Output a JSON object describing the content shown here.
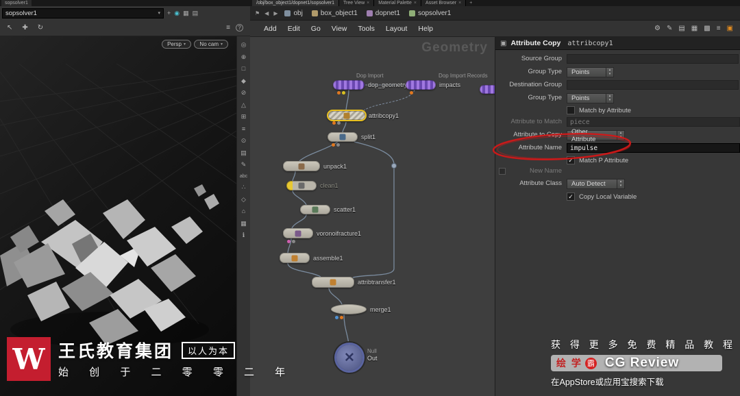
{
  "tabs_bar": {
    "left_tab": "sopsolver1",
    "path_tab": "/obj/box_object1/dopnet1/sopsolver1",
    "tabs": [
      "Tree View",
      "Material Palette",
      "Asset Browser"
    ],
    "close_glyph": "×",
    "add_glyph": "+"
  },
  "viewport": {
    "path_value": "sopsolver1",
    "dropdown_arrow": "▾",
    "header_icons": [
      "+",
      "◉",
      "▦",
      "▤"
    ],
    "toolbar_icons": [
      "↖",
      "✚",
      "↻"
    ],
    "toolbar_right_icons": [
      "≡",
      "?"
    ],
    "persp_label": "Persp",
    "cam_label": "No cam",
    "side_icons": [
      "◎",
      "⊕",
      "□",
      "◆",
      "⊘",
      "△",
      "⊞",
      "≡",
      "⊙",
      "▤",
      "✎",
      "abc",
      "∴",
      "◇",
      "⌂",
      "▦",
      "ℹ"
    ]
  },
  "network": {
    "pin_glyph": "⚑",
    "back_glyph": "◀",
    "forward_glyph": "▶",
    "breadcrumb": [
      "obj",
      "box_object1",
      "dopnet1",
      "sopsolver1"
    ],
    "menu": [
      "Add",
      "Edit",
      "Go",
      "View",
      "Tools",
      "Layout",
      "Help"
    ],
    "right_icons": [
      "⚙",
      "✎",
      "▤",
      "▦",
      "▩",
      "≡",
      "▣"
    ],
    "watermark": "Geometry",
    "nodes": {
      "dop_geometry": {
        "type": "Dop Import",
        "label": "dop_geometry"
      },
      "impacts": {
        "type": "Dop Import Records",
        "label": "impacts"
      },
      "attribcopy": {
        "label": "attribcopy1"
      },
      "split": {
        "label": "split1"
      },
      "unpack": {
        "label": "unpack1"
      },
      "clean": {
        "label": "clean1"
      },
      "scatter": {
        "label": "scatter1"
      },
      "voronoifracture": {
        "label": "voronoifracture1"
      },
      "assemble": {
        "label": "assemble1"
      },
      "attribtransfer": {
        "label": "attribtransfer1"
      },
      "merge": {
        "label": "merge1"
      },
      "out": {
        "type": "Null",
        "label": "Out",
        "glyph": "✕"
      }
    }
  },
  "params": {
    "header": {
      "type": "Attribute Copy",
      "name": "attribcopy1"
    },
    "spinner_up": "▴",
    "spinner_down": "▾",
    "rows": {
      "source_group": {
        "label": "Source Group",
        "value": ""
      },
      "group_type_src": {
        "label": "Group Type",
        "value": "Points"
      },
      "destination_group": {
        "label": "Destination Group",
        "value": ""
      },
      "group_type_dst": {
        "label": "Group Type",
        "value": "Points"
      },
      "match_by_attribute": {
        "label": "Match by Attribute",
        "check": ""
      },
      "attribute_to_match": {
        "label": "Attribute to Match",
        "value": "piece"
      },
      "attribute_to_copy": {
        "label": "Attribute to Copy",
        "value": "Other Attribute"
      },
      "attribute_name": {
        "label": "Attribute Name",
        "value": "impulse"
      },
      "match_p_attribute": {
        "label": "Match P Attribute",
        "check": "✓"
      },
      "new_name": {
        "label": "New Name",
        "value": ""
      },
      "attribute_class": {
        "label": "Attribute Class",
        "value": "Auto Detect"
      },
      "copy_local_variable": {
        "label": "Copy Local Variable",
        "check": "✓"
      }
    }
  },
  "branding": {
    "logo_letter": "W",
    "company": "王氏教育集团",
    "motto": "以人为本",
    "slogan": "始 创 于 二 零 零 二 年"
  },
  "promo": {
    "line1": "获 得 更 多 免 费 精 品 教 程",
    "brand": "绘 学",
    "brand_badge": "霸",
    "app_name": "CG Review",
    "line3": "在AppStore或应用宝搜索下载"
  }
}
